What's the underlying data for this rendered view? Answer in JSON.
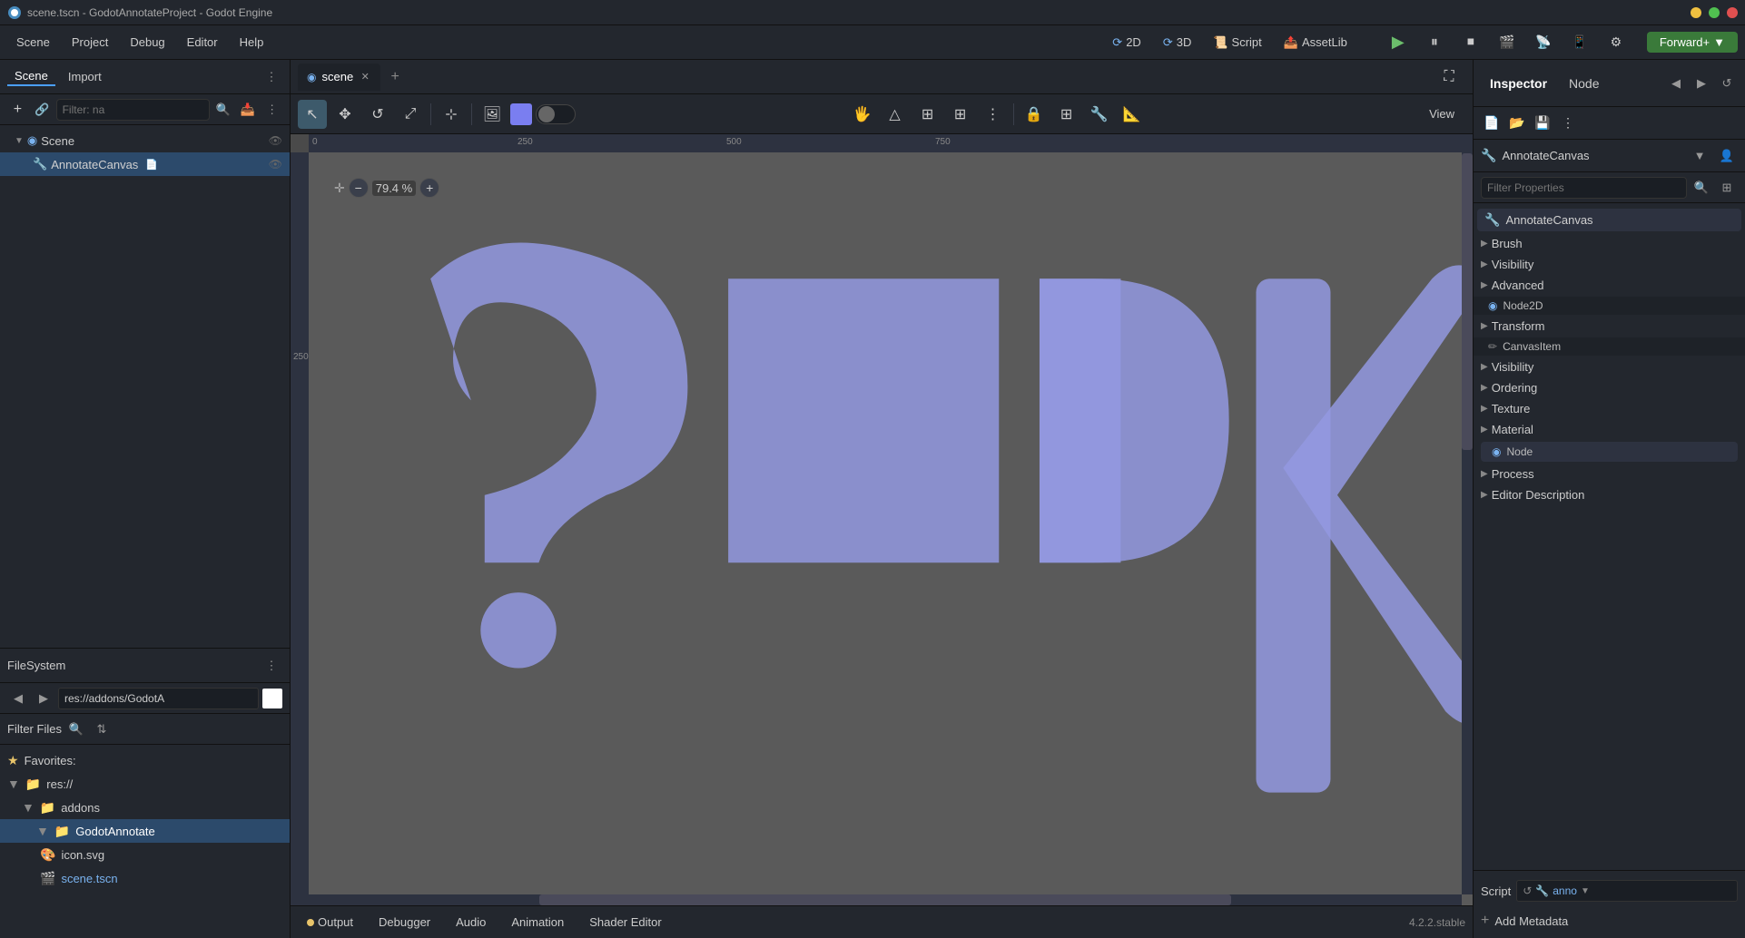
{
  "titlebar": {
    "title": "scene.tscn - GodotAnnotateProject - Godot Engine",
    "icon": "godot-icon"
  },
  "menubar": {
    "items": [
      "Scene",
      "Project",
      "Debug",
      "Editor",
      "Help"
    ]
  },
  "toolbar": {
    "mode_2d": "2D",
    "mode_3d": "3D",
    "mode_script": "Script",
    "mode_assetlib": "AssetLib",
    "forward_label": "Forward+",
    "forward_arrow": "▼"
  },
  "left_panel": {
    "tabs": [
      "Scene",
      "Import"
    ],
    "filter_placeholder": "Filter: na",
    "tree": {
      "root": {
        "label": "Scene",
        "icon": "circle-icon",
        "children": [
          {
            "label": "AnnotateCanvas",
            "icon": "annotate-icon",
            "selected": true
          }
        ]
      }
    }
  },
  "filesystem": {
    "title": "FileSystem",
    "path": "res://addons/GodotA",
    "filter_label": "Filter Files",
    "items": [
      {
        "type": "star",
        "label": "Favorites:",
        "indent": 0
      },
      {
        "type": "folder",
        "label": "res://",
        "indent": 0,
        "expanded": true
      },
      {
        "type": "folder",
        "label": "addons",
        "indent": 1,
        "expanded": true
      },
      {
        "type": "folder-blue",
        "label": "GodotAnnotate",
        "indent": 2,
        "selected": true
      },
      {
        "type": "file",
        "label": "icon.svg",
        "indent": 1
      },
      {
        "type": "tscn",
        "label": "scene.tscn",
        "indent": 1
      }
    ]
  },
  "editor_tabs": {
    "tabs": [
      {
        "label": "scene",
        "icon": "scene-icon",
        "active": true,
        "closable": true
      }
    ]
  },
  "editor_toolbar": {
    "tools": [
      "select",
      "move",
      "rotate",
      "scale",
      "ruler",
      "hand",
      "triangle",
      "grid1",
      "grid2",
      "more",
      "lock",
      "grid3",
      "pipette",
      "stamp"
    ],
    "view_label": "View"
  },
  "canvas": {
    "zoom": "79.4 %",
    "ruler_marks_h": [
      "0",
      "250",
      "500",
      "750"
    ],
    "ruler_marks_v": [
      "250"
    ]
  },
  "bottom_tabs": {
    "tabs": [
      "Output",
      "Debugger",
      "Audio",
      "Animation",
      "Shader Editor"
    ],
    "output_dot_color": "#e8c46a",
    "version": "4.2.2.stable"
  },
  "inspector": {
    "tabs": [
      "Inspector",
      "Node"
    ],
    "node_name": "AnnotateCanvas",
    "node_icon": "annotate-icon",
    "filter_placeholder": "Filter Properties",
    "sections": [
      {
        "type": "node",
        "label": "AnnotateCanvas",
        "icon": "annotate-icon"
      },
      {
        "type": "section",
        "label": "Brush",
        "expanded": true
      },
      {
        "type": "section",
        "label": "Visibility",
        "expanded": true
      },
      {
        "type": "section",
        "label": "Advanced",
        "expanded": true
      },
      {
        "type": "subsection",
        "label": "Node2D",
        "icon": "circle-icon"
      },
      {
        "type": "section",
        "label": "Transform",
        "expanded": true
      },
      {
        "type": "subsection",
        "label": "CanvasItem",
        "icon": "pencil-icon"
      },
      {
        "type": "section",
        "label": "Visibility",
        "expanded": true
      },
      {
        "type": "section",
        "label": "Ordering",
        "expanded": true
      },
      {
        "type": "section",
        "label": "Texture",
        "expanded": true
      },
      {
        "type": "section",
        "label": "Material",
        "expanded": true
      },
      {
        "type": "node-sub",
        "label": "Node",
        "icon": "circle-icon"
      },
      {
        "type": "section",
        "label": "Process",
        "expanded": true
      },
      {
        "type": "section",
        "label": "Editor Description",
        "expanded": true
      }
    ],
    "script_label": "Script",
    "script_value": "anno",
    "script_icon": "refresh-icon",
    "script_node_icon": "annotate-icon",
    "add_metadata_label": "Add Metadata"
  },
  "colors": {
    "accent_blue": "#4a9fff",
    "draw_color": "#7a7ef0",
    "folder_selected": "#2c6bbf",
    "canvas_bg": "#5a5a5a"
  }
}
